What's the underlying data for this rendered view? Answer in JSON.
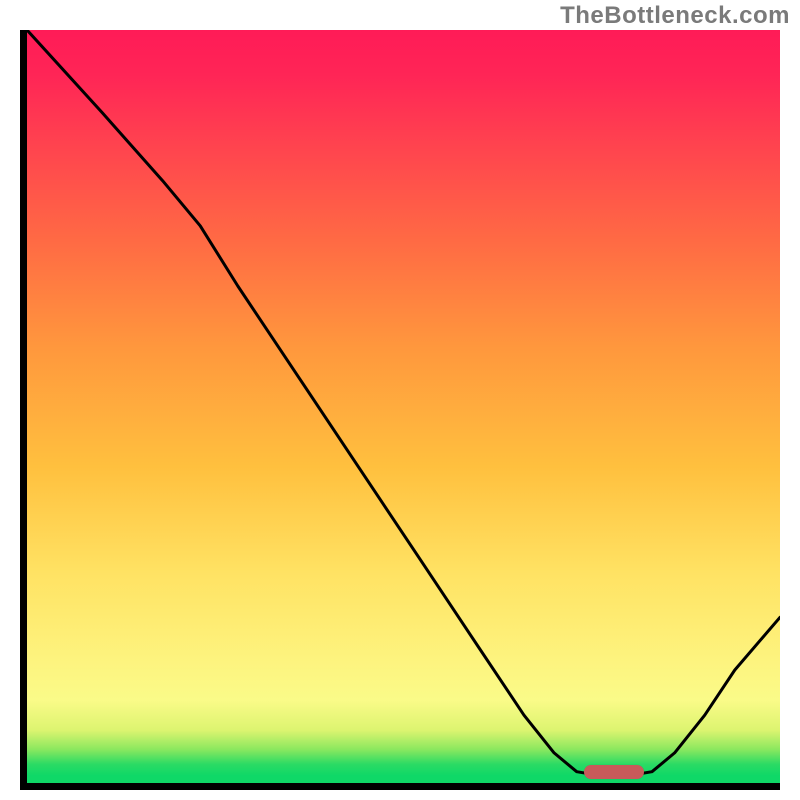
{
  "watermark": "TheBottleneck.com",
  "colors": {
    "border": "#000000",
    "curve": "#000000",
    "marker": "#c85a5a",
    "gradient_stops": [
      {
        "pct": 0,
        "hex": "#0fd867"
      },
      {
        "pct": 1.0,
        "hex": "#0fd867"
      },
      {
        "pct": 2.5,
        "hex": "#2bdb64"
      },
      {
        "pct": 4.5,
        "hex": "#8ce85f"
      },
      {
        "pct": 7,
        "hex": "#dcf470"
      },
      {
        "pct": 11,
        "hex": "#fafb88"
      },
      {
        "pct": 16,
        "hex": "#fdf47f"
      },
      {
        "pct": 28,
        "hex": "#ffe263"
      },
      {
        "pct": 42,
        "hex": "#ffc03e"
      },
      {
        "pct": 58,
        "hex": "#ff973d"
      },
      {
        "pct": 72,
        "hex": "#ff6a44"
      },
      {
        "pct": 85,
        "hex": "#ff424f"
      },
      {
        "pct": 94,
        "hex": "#ff2556"
      },
      {
        "pct": 100,
        "hex": "#ff1b57"
      }
    ]
  },
  "chart_data": {
    "type": "line",
    "title": "",
    "xlabel": "",
    "ylabel": "",
    "xlim": [
      0,
      100
    ],
    "ylim": [
      0,
      100
    ],
    "sweet_spot_x_range": [
      74,
      82
    ],
    "curve": [
      {
        "x": 0,
        "y": 100
      },
      {
        "x": 10,
        "y": 89
      },
      {
        "x": 18,
        "y": 80
      },
      {
        "x": 23,
        "y": 74
      },
      {
        "x": 28,
        "y": 66
      },
      {
        "x": 36,
        "y": 54
      },
      {
        "x": 44,
        "y": 42
      },
      {
        "x": 52,
        "y": 30
      },
      {
        "x": 60,
        "y": 18
      },
      {
        "x": 66,
        "y": 9
      },
      {
        "x": 70,
        "y": 4
      },
      {
        "x": 73,
        "y": 1.5
      },
      {
        "x": 76,
        "y": 1.0
      },
      {
        "x": 80,
        "y": 1.0
      },
      {
        "x": 83,
        "y": 1.5
      },
      {
        "x": 86,
        "y": 4
      },
      {
        "x": 90,
        "y": 9
      },
      {
        "x": 94,
        "y": 15
      },
      {
        "x": 100,
        "y": 22
      }
    ]
  }
}
